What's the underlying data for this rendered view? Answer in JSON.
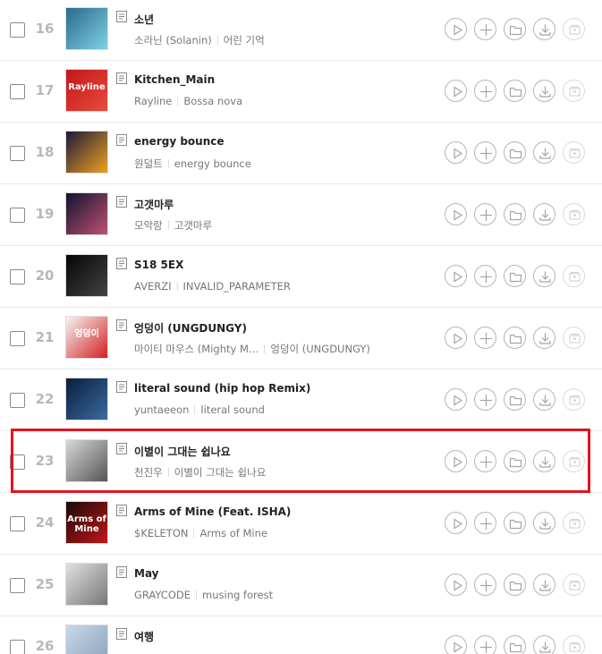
{
  "songs": [
    {
      "rank": "16",
      "title": "소년",
      "artist": "소라닌 (Solanin)",
      "album": "어린 기억",
      "cover": [
        "#2a6a8a",
        "#7fd0e8"
      ]
    },
    {
      "rank": "17",
      "title": "Kitchen_Main",
      "artist": "Rayline",
      "album": "Bossa nova",
      "cover": [
        "#c2161c",
        "#e94b3c"
      ],
      "cover_text": "Rayline"
    },
    {
      "rank": "18",
      "title": "energy bounce",
      "artist": "원덜트",
      "album": "energy bounce",
      "cover": [
        "#1a1a3a",
        "#f0a020"
      ]
    },
    {
      "rank": "19",
      "title": "고갯마루",
      "artist": "모악랑",
      "album": "고갯마루",
      "cover": [
        "#0f1530",
        "#c05070"
      ]
    },
    {
      "rank": "20",
      "title": "S18 5EX",
      "artist": "AVERZI",
      "album": "INVALID_PARAMETER",
      "cover": [
        "#050505",
        "#444"
      ]
    },
    {
      "rank": "21",
      "title": "엉덩이 (UNGDUNGY)",
      "artist": "마이티 마우스 (Mighty M…",
      "album": "엉덩이 (UNGDUNGY)",
      "cover": [
        "#f5f5f5",
        "#d42020"
      ],
      "cover_text": "엉덩이"
    },
    {
      "rank": "22",
      "title": "literal sound (hip hop Remix)",
      "artist": "yuntaeeon",
      "album": "literal sound",
      "cover": [
        "#0a1e3c",
        "#3a6aa0"
      ]
    },
    {
      "rank": "23",
      "title": "이별이 그대는 쉽나요",
      "artist": "천진우",
      "album": "이별이 그대는 쉽나요",
      "cover": [
        "#d8d8d8",
        "#555"
      ]
    },
    {
      "rank": "24",
      "title": "Arms of Mine (Feat. ISHA)",
      "artist": "$KELETON",
      "album": "Arms of Mine",
      "cover": [
        "#1a0808",
        "#c01818"
      ],
      "cover_text": "Arms of Mine"
    },
    {
      "rank": "25",
      "title": "May",
      "artist": "GRAYCODE",
      "album": "musing forest",
      "cover": [
        "#e0e0e0",
        "#777"
      ]
    },
    {
      "rank": "26",
      "title": "여행",
      "artist": "",
      "album": "",
      "cover": [
        "#c8d8e8",
        "#8aa0b8"
      ]
    }
  ],
  "actions": [
    "play-icon",
    "add-icon",
    "folder-icon",
    "download-icon",
    "mv-icon"
  ],
  "colors": {
    "highlight": "#e0141e",
    "rank": "#b8b8b8"
  }
}
